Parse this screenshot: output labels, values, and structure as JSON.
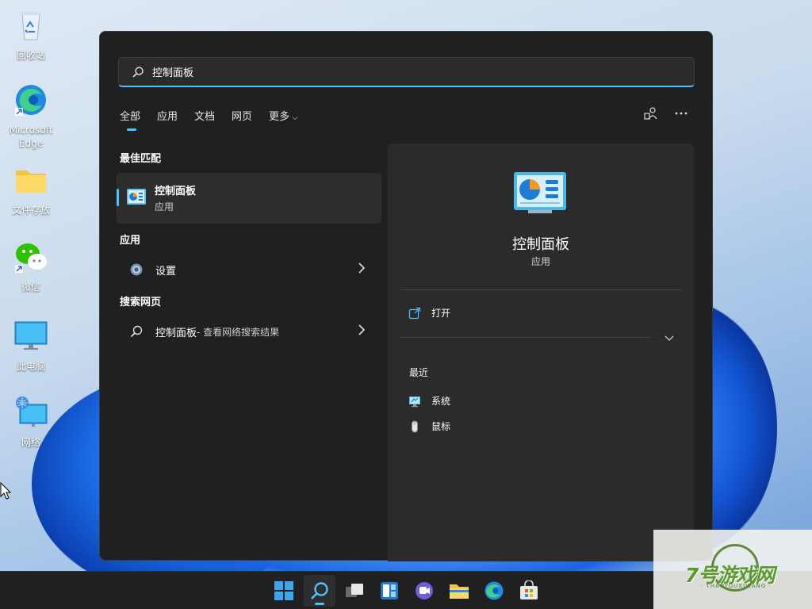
{
  "desktop": {
    "icons": [
      {
        "label": "回收站",
        "icon": "recycle-bin-icon"
      },
      {
        "label": "Microsoft Edge",
        "icon": "edge-icon"
      },
      {
        "label": "文件存放",
        "icon": "folder-icon"
      },
      {
        "label": "微信",
        "icon": "wechat-icon"
      },
      {
        "label": "此电脑",
        "icon": "this-pc-icon"
      },
      {
        "label": "网络",
        "icon": "network-icon"
      }
    ]
  },
  "search": {
    "query": "控制面板",
    "icon": "search-icon"
  },
  "tabs": [
    {
      "label": "全部",
      "active": true
    },
    {
      "label": "应用"
    },
    {
      "label": "文档"
    },
    {
      "label": "网页"
    },
    {
      "label": "更多"
    }
  ],
  "results": {
    "best_match_heading": "最佳匹配",
    "best_match": {
      "title": "控制面板",
      "subtitle": "应用",
      "icon": "control-panel-icon"
    },
    "apps_heading": "应用",
    "apps": [
      {
        "label": "设置",
        "icon": "settings-gear-icon"
      }
    ],
    "web_heading": "搜索网页",
    "web": [
      {
        "label": "控制面板",
        "suffix": " - 查看网络搜索结果",
        "icon": "search-icon"
      }
    ]
  },
  "detail": {
    "title": "控制面板",
    "kind": "应用",
    "open_label": "打开",
    "recent_heading": "最近",
    "recent": [
      {
        "label": "系统",
        "icon": "system-icon"
      },
      {
        "label": "鼠标",
        "icon": "mouse-icon"
      }
    ]
  },
  "taskbar": {
    "items": [
      {
        "name": "start-button",
        "icon": "windows-logo-icon"
      },
      {
        "name": "search-button",
        "icon": "search-icon",
        "active": true
      },
      {
        "name": "task-view-button",
        "icon": "task-view-icon"
      },
      {
        "name": "widgets-button",
        "icon": "widgets-icon"
      },
      {
        "name": "chat-button",
        "icon": "chat-icon"
      },
      {
        "name": "file-explorer-button",
        "icon": "folder-icon"
      },
      {
        "name": "edge-button",
        "icon": "edge-icon"
      },
      {
        "name": "store-button",
        "icon": "store-icon"
      }
    ]
  },
  "watermark": {
    "brand": "7号游戏网",
    "sub": "· THAOYOUXIWANG ·"
  },
  "colors": {
    "accent": "#4cc2ff",
    "panel": "#202020",
    "card": "#2b2b2b"
  }
}
